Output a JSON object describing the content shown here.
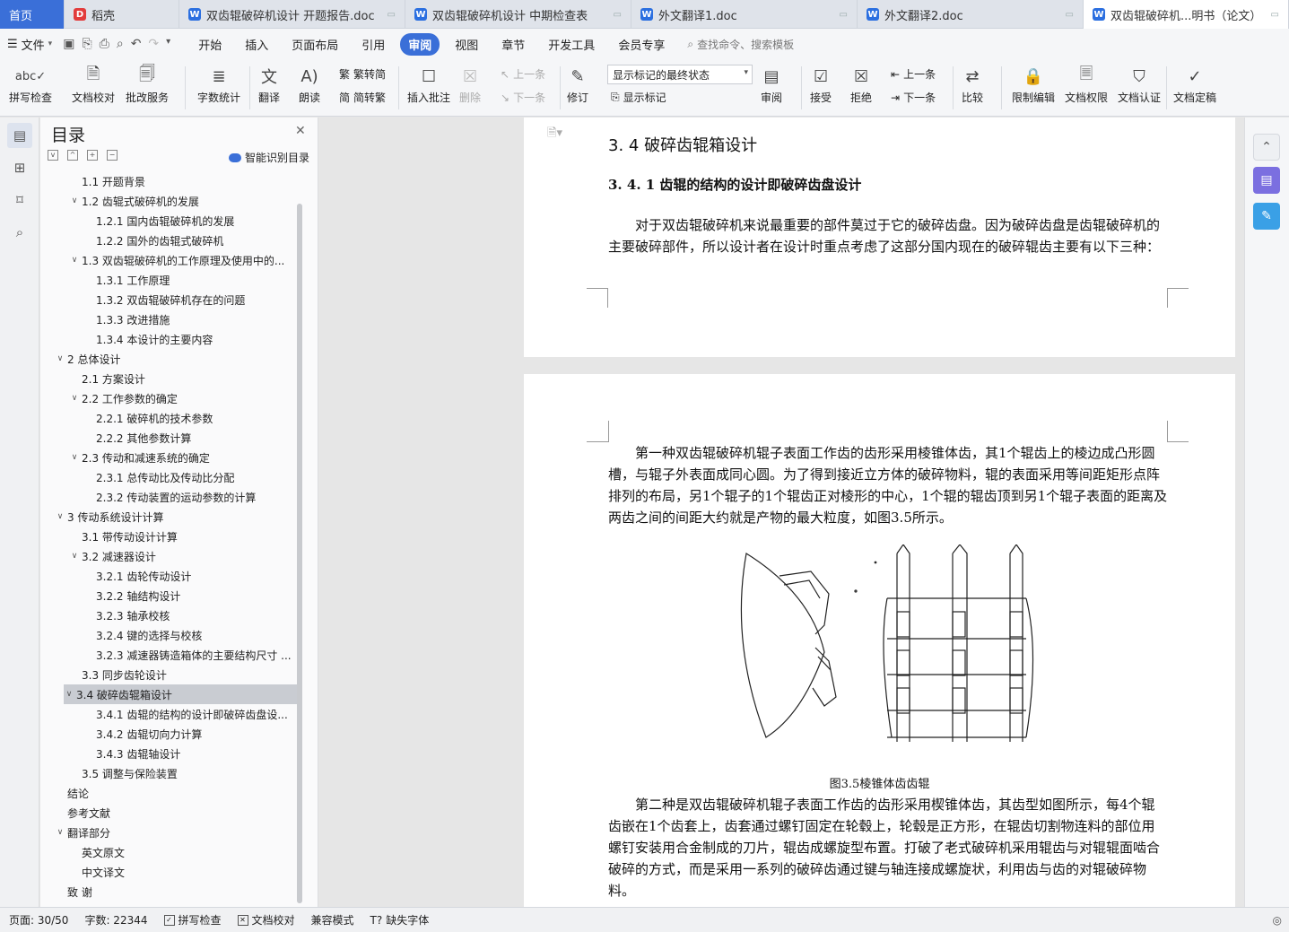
{
  "tabs": [
    {
      "label": "首页",
      "type": "home"
    },
    {
      "label": "稻壳",
      "icon": "docer-icon",
      "iconColor": "#e23b3b",
      "iconGlyph": "D"
    },
    {
      "label": "双齿辊破碎机设计 开题报告.doc",
      "icon": "word-icon",
      "iconColor": "#2b6fe0",
      "iconGlyph": "W"
    },
    {
      "label": "双齿辊破碎机设计 中期检查表",
      "icon": "word-icon",
      "iconColor": "#2b6fe0",
      "iconGlyph": "W"
    },
    {
      "label": "外文翻译1.doc",
      "icon": "word-icon",
      "iconColor": "#2b6fe0",
      "iconGlyph": "W"
    },
    {
      "label": "外文翻译2.doc",
      "icon": "word-icon",
      "iconColor": "#2b6fe0",
      "iconGlyph": "W"
    },
    {
      "label": "双齿辊破碎机...明书（论文）",
      "icon": "word-icon",
      "iconColor": "#2b6fe0",
      "iconGlyph": "W",
      "active": true
    }
  ],
  "menu": {
    "file_label": "文件",
    "tabs": [
      "开始",
      "插入",
      "页面布局",
      "引用",
      "审阅",
      "视图",
      "章节",
      "开发工具",
      "会员专享"
    ],
    "active_tab": "审阅",
    "search_label": "查找命令、搜索模板"
  },
  "ribbon": {
    "spellcheck": "拼写检查",
    "proofread": "文档校对",
    "correction_service": "批改服务",
    "word_count": "字数统计",
    "translate": "翻译",
    "read_aloud": "朗读",
    "trad_to_simp": "繁转简",
    "simp_to_trad": "简转繁",
    "insert_comment": "插入批注",
    "delete": "删除",
    "prev_comment": "上一条",
    "next_comment": "下一条",
    "track_changes": "修订",
    "markup_select": "显示标记的最终状态",
    "show_markup": "显示标记",
    "review_pane": "审阅",
    "accept": "接受",
    "reject": "拒绝",
    "prev_change": "上一条",
    "next_change": "下一条",
    "compare": "比较",
    "restrict_edit": "限制编辑",
    "doc_permission": "文档权限",
    "doc_certify": "文档认证",
    "doc_finalize": "文档定稿"
  },
  "toc": {
    "title": "目录",
    "smart_label": "智能识别目录",
    "items": [
      {
        "label": "1.1 开题背景",
        "level": 2,
        "caret": ""
      },
      {
        "label": "1.2 齿辊式破碎机的发展",
        "level": 2,
        "caret": "v"
      },
      {
        "label": "1.2.1 国内齿辊破碎机的发展",
        "level": 3,
        "caret": ""
      },
      {
        "label": "1.2.2 国外的齿辊式破碎机",
        "level": 3,
        "caret": ""
      },
      {
        "label": "1.3 双齿辊破碎机的工作原理及使用中的...",
        "level": 2,
        "caret": "v"
      },
      {
        "label": "1.3.1 工作原理",
        "level": 3,
        "caret": ""
      },
      {
        "label": "1.3.2 双齿辊破碎机存在的问题",
        "level": 3,
        "caret": ""
      },
      {
        "label": "1.3.3 改进措施",
        "level": 3,
        "caret": ""
      },
      {
        "label": "1.3.4 本设计的主要内容",
        "level": 3,
        "caret": ""
      },
      {
        "label": "2  总体设计",
        "level": 1,
        "caret": "v"
      },
      {
        "label": "2.1 方案设计",
        "level": 2,
        "caret": ""
      },
      {
        "label": "2.2 工作参数的确定",
        "level": 2,
        "caret": "v"
      },
      {
        "label": "2.2.1 破碎机的技术参数",
        "level": 3,
        "caret": ""
      },
      {
        "label": "2.2.2 其他参数计算",
        "level": 3,
        "caret": ""
      },
      {
        "label": "2.3 传动和减速系统的确定",
        "level": 2,
        "caret": "v"
      },
      {
        "label": "2.3.1 总传动比及传动比分配",
        "level": 3,
        "caret": ""
      },
      {
        "label": "2.3.2 传动装置的运动参数的计算",
        "level": 3,
        "caret": ""
      },
      {
        "label": "3  传动系统设计计算",
        "level": 1,
        "caret": "v"
      },
      {
        "label": "3.1  带传动设计计算",
        "level": 2,
        "caret": ""
      },
      {
        "label": "3.2 减速器设计",
        "level": 2,
        "caret": "v"
      },
      {
        "label": "3.2.1 齿轮传动设计",
        "level": 3,
        "caret": ""
      },
      {
        "label": "3.2.2 轴结构设计",
        "level": 3,
        "caret": ""
      },
      {
        "label": "3.2.3 轴承校核",
        "level": 3,
        "caret": ""
      },
      {
        "label": "3.2.4 键的选择与校核",
        "level": 3,
        "caret": ""
      },
      {
        "label": "3.2.3 减速器铸造箱体的主要结构尺寸 ...",
        "level": 3,
        "caret": ""
      },
      {
        "label": "3.3 同步齿轮设计",
        "level": 2,
        "caret": ""
      },
      {
        "label": "3.4 破碎齿辊箱设计",
        "level": 2,
        "caret": "v",
        "selected": true
      },
      {
        "label": "3.4.1 齿辊的结构的设计即破碎齿盘设...",
        "level": 3,
        "caret": ""
      },
      {
        "label": "3.4.2 齿辊切向力计算",
        "level": 3,
        "caret": ""
      },
      {
        "label": "3.4.3 齿辊轴设计",
        "level": 3,
        "caret": ""
      },
      {
        "label": "3.5 调整与保险装置",
        "level": 2,
        "caret": ""
      },
      {
        "label": "结论",
        "level": 1,
        "caret": ""
      },
      {
        "label": "参考文献",
        "level": 1,
        "caret": ""
      },
      {
        "label": "翻译部分",
        "level": 1,
        "caret": "v"
      },
      {
        "label": "英文原文",
        "level": 2,
        "caret": ""
      },
      {
        "label": "中文译文",
        "level": 2,
        "caret": ""
      },
      {
        "label": "致   谢",
        "level": 1,
        "caret": ""
      }
    ]
  },
  "document": {
    "heading3": "3. 4 破碎齿辊箱设计",
    "heading4": "3. 4. 1 齿辊的结构的设计即破碎齿盘设计",
    "para1": "对于双齿辊破碎机来说最重要的部件莫过于它的破碎齿盘。因为破碎齿盘是齿辊破碎机的主要破碎部件，所以设计者在设计时重点考虑了这部分国内现在的破碎辊齿主要有以下三种：",
    "para2": "第一种双齿辊破碎机辊子表面工作齿的齿形采用棱锥体齿，其1个辊齿上的棱边成凸形圆槽，与辊子外表面成同心圆。为了得到接近立方体的破碎物料，辊的表面采用等间距矩形点阵排列的布局，另1个辊子的1个辊齿正对棱形的中心，1个辊的辊齿顶到另1个辊子表面的距离及两齿之间的间距大约就是产物的最大粒度，如图3.5所示。",
    "figure_caption": "图3.5棱锥体齿齿辊",
    "para3": "第二种是双齿辊破碎机辊子表面工作齿的齿形采用楔锥体齿，其齿型如图所示，每4个辊齿嵌在1个齿套上，齿套通过螺钉固定在轮毂上，轮毂是正方形，在辊齿切割物连料的部位用螺钉安装用合金制成的刀片，辊齿成螺旋型布置。打破了老式破碎机采用辊齿与对辊辊面啮合破碎的方式，而是采用一系列的破碎齿通过键与轴连接成螺旋状，利用齿与齿的对辊破碎物料。"
  },
  "status": {
    "page": "页面: 30/50",
    "word_count": "字数: 22344",
    "spellcheck": "拼写检查",
    "proofread": "文档校对",
    "compat_mode": "兼容模式",
    "missing_font": "缺失字体"
  },
  "colors": {
    "accent": "#3a6fd8",
    "rr_purple": "#7b6fe0",
    "rr_blue": "#3aa0e6"
  }
}
